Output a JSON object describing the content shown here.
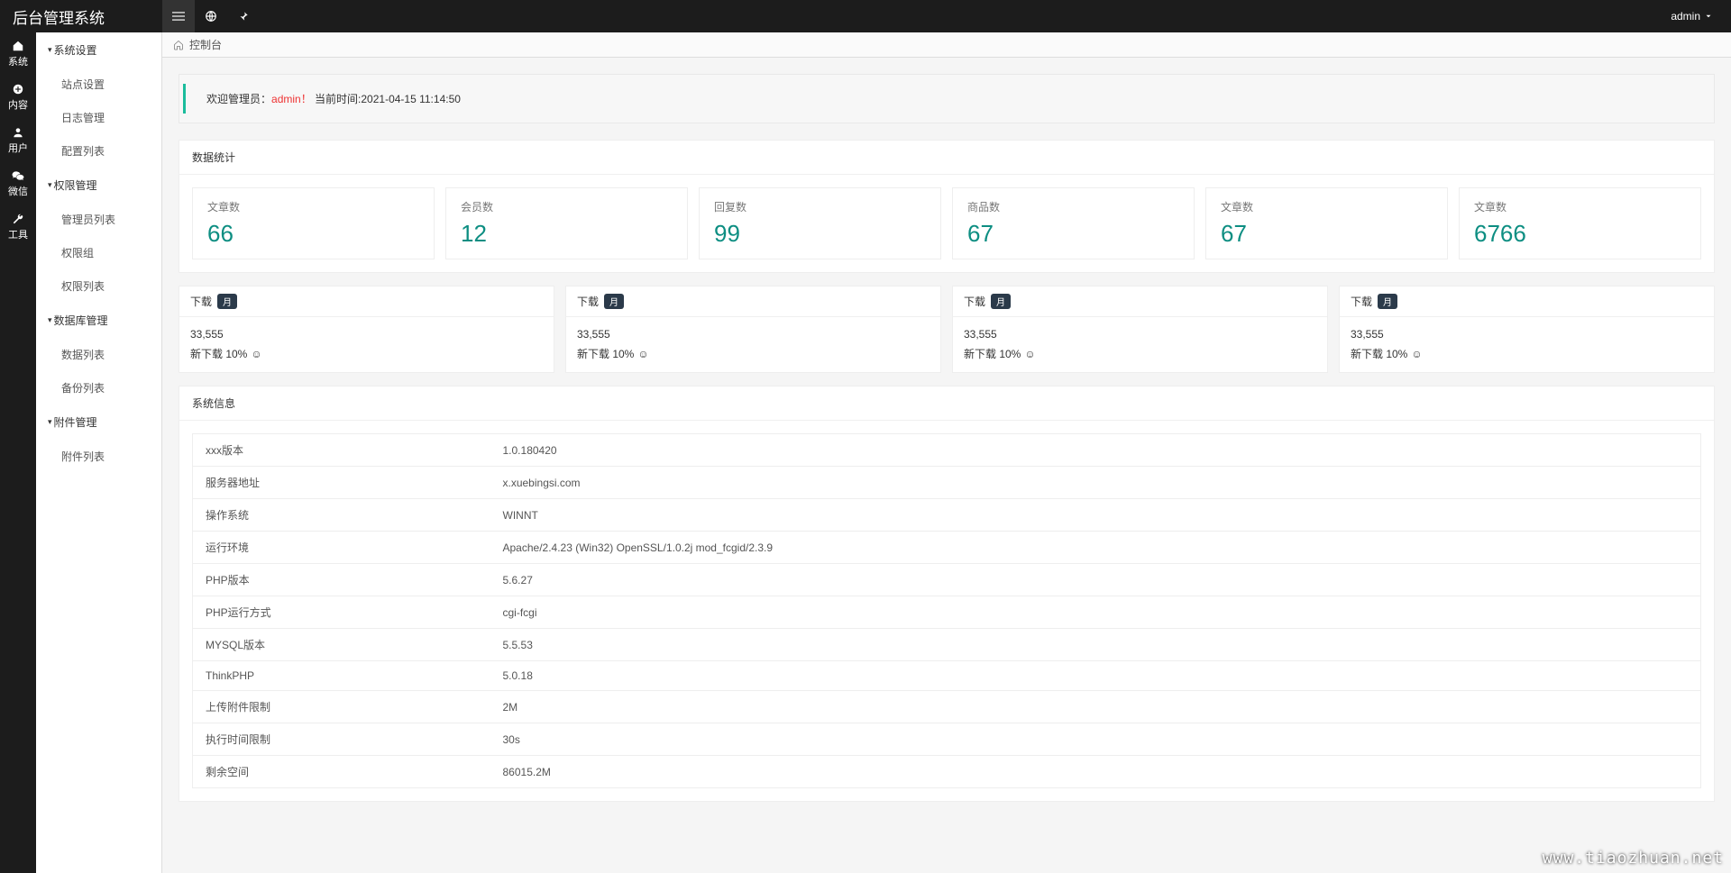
{
  "topbar": {
    "brand": "后台管理系统",
    "admin_label": "admin"
  },
  "rail": [
    {
      "icon": "home",
      "label": "系统"
    },
    {
      "icon": "plus-circle",
      "label": "内容"
    },
    {
      "icon": "users",
      "label": "用户"
    },
    {
      "icon": "wechat",
      "label": "微信"
    },
    {
      "icon": "wrench",
      "label": "工具"
    }
  ],
  "sidebar": {
    "groups": [
      {
        "title": "系统设置",
        "items": [
          "站点设置",
          "日志管理",
          "配置列表"
        ]
      },
      {
        "title": "权限管理",
        "items": [
          "管理员列表",
          "权限组",
          "权限列表"
        ]
      },
      {
        "title": "数据库管理",
        "items": [
          "数据列表",
          "备份列表"
        ]
      },
      {
        "title": "附件管理",
        "items": [
          "附件列表"
        ]
      }
    ]
  },
  "breadcrumb": {
    "label": "控制台"
  },
  "welcome": {
    "pre": "欢迎管理员：",
    "admin": "admin！",
    "post": "当前时间:2021-04-15 11:14:50"
  },
  "stats_panel_title": "数据统计",
  "stats": [
    {
      "label": "文章数",
      "value": "66"
    },
    {
      "label": "会员数",
      "value": "12"
    },
    {
      "label": "回复数",
      "value": "99"
    },
    {
      "label": "商品数",
      "value": "67"
    },
    {
      "label": "文章数",
      "value": "67"
    },
    {
      "label": "文章数",
      "value": "6766"
    }
  ],
  "downloads": [
    {
      "title": "下载",
      "badge": "月",
      "count": "33,555",
      "sub": "新下载 10%"
    },
    {
      "title": "下载",
      "badge": "月",
      "count": "33,555",
      "sub": "新下载 10%"
    },
    {
      "title": "下载",
      "badge": "月",
      "count": "33,555",
      "sub": "新下载 10%"
    },
    {
      "title": "下载",
      "badge": "月",
      "count": "33,555",
      "sub": "新下载 10%"
    }
  ],
  "sysinfo_title": "系统信息",
  "sysinfo": [
    {
      "k": "xxx版本",
      "v": "1.0.180420"
    },
    {
      "k": "服务器地址",
      "v": "x.xuebingsi.com"
    },
    {
      "k": "操作系统",
      "v": "WINNT"
    },
    {
      "k": "运行环境",
      "v": "Apache/2.4.23 (Win32) OpenSSL/1.0.2j mod_fcgid/2.3.9"
    },
    {
      "k": "PHP版本",
      "v": "5.6.27"
    },
    {
      "k": "PHP运行方式",
      "v": "cgi-fcgi"
    },
    {
      "k": "MYSQL版本",
      "v": "5.5.53"
    },
    {
      "k": "ThinkPHP",
      "v": "5.0.18"
    },
    {
      "k": "上传附件限制",
      "v": "2M"
    },
    {
      "k": "执行时间限制",
      "v": "30s"
    },
    {
      "k": "剩余空间",
      "v": "86015.2M"
    }
  ],
  "watermark": "www.tiaozhuan.net"
}
